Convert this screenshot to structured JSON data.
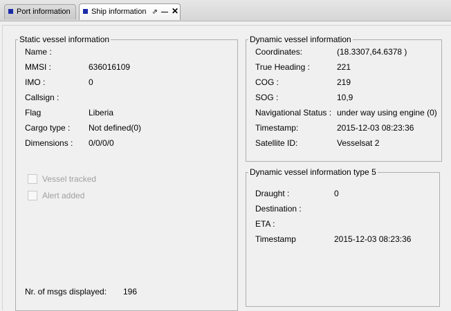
{
  "tabs": [
    {
      "label": "Port information"
    },
    {
      "label": "Ship information"
    }
  ],
  "static": {
    "title": "Static vessel information",
    "fields": [
      {
        "label": "Name :",
        "value": ""
      },
      {
        "label": "MMSI :",
        "value": "636016109"
      },
      {
        "label": "IMO :",
        "value": "0"
      },
      {
        "label": "Callsign :",
        "value": ""
      },
      {
        "label": "Flag",
        "value": "Liberia"
      },
      {
        "label": "Cargo type :",
        "value": "Not defined(0)"
      },
      {
        "label": "Dimensions :",
        "value": "0/0/0/0"
      }
    ],
    "checkboxes": [
      {
        "label": "Vessel tracked",
        "checked": false
      },
      {
        "label": "Alert added",
        "checked": false
      }
    ],
    "msgs_label": "Nr. of msgs displayed:",
    "msgs_value": "196"
  },
  "dynamic": {
    "title": "Dynamic vessel information",
    "fields": [
      {
        "label": "Coordinates:",
        "value": "(18.3307,64.6378 )"
      },
      {
        "label": "True Heading :",
        "value": "221"
      },
      {
        "label": "COG :",
        "value": "219"
      },
      {
        "label": "SOG :",
        "value": "10,9"
      },
      {
        "label": "Navigational Status :",
        "value": "under way using engine (0)"
      },
      {
        "label": "Timestamp:",
        "value": "2015-12-03 08:23:36"
      },
      {
        "label": "Satellite ID:",
        "value": "Vesselsat 2"
      }
    ]
  },
  "type5": {
    "title": "Dynamic vessel information type 5",
    "fields": [
      {
        "label": "Draught :",
        "value": "0"
      },
      {
        "label": "Destination :",
        "value": ""
      },
      {
        "label": "ETA :",
        "value": ""
      },
      {
        "label": "Timestamp",
        "value": "2015-12-03 08:23:36"
      }
    ]
  }
}
